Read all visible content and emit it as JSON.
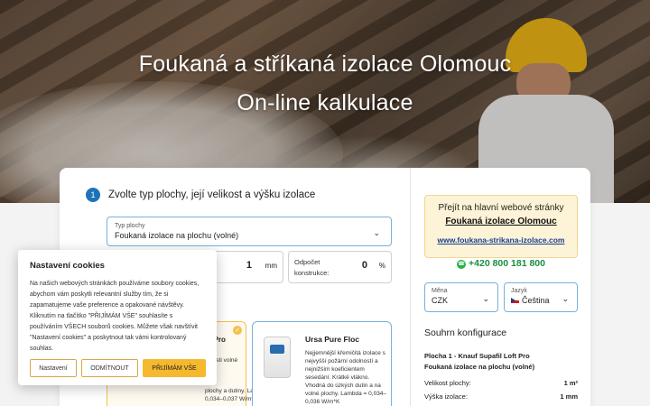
{
  "hero": {
    "title": "Foukaná a stříkaná izolace Olomouc",
    "subtitle": "On-line kalkulace"
  },
  "step1": {
    "number": "1",
    "label": "Zvolte typ plochy, její velikost a výšku izolace"
  },
  "surface_select": {
    "label": "Typ plochy",
    "value": "Foukaná izolace na plochu (volné)"
  },
  "area_field": {
    "value": "1",
    "unit": "mm"
  },
  "deduction_field": {
    "label": "Odpočet konstrukce:",
    "value": "0",
    "unit": "%"
  },
  "products": [
    {
      "name": "ft Pro",
      "desc_part1": "s nosti volné",
      "desc_part2": "plochy a dutiny. Lambda = 0,034–0,037 W/m*K"
    },
    {
      "name": "Ursa Pure Floc",
      "desc": "Nejjemnější křemičitá izolace s nejvyšší požární odolností a nejnižším koeficientem sesedání. Krátké vlákno. Vhodná do úzkých dutin a na volné plochy. Lambda = 0,034–0,036 W/m*K"
    }
  ],
  "promo": {
    "line1": "Přejít na hlavní webové stránky",
    "line2": "Foukaná izolace Olomouc",
    "link": "www.foukana-strikana-izolace.com"
  },
  "phone": "+420 800 181 800",
  "currency": {
    "label": "Měna",
    "value": "CZK"
  },
  "language": {
    "label": "Jazyk",
    "value": "Čeština"
  },
  "summary": {
    "title": "Souhrn konfigurace",
    "line1": "Plocha 1 - Knauf Supafil Loft Pro",
    "line2": "Foukaná izolace na plochu (volné)",
    "rows": [
      {
        "label": "Velikost plochy:",
        "value": "1 m²"
      },
      {
        "label": "Výška izolace:",
        "value": "1 mm"
      }
    ]
  },
  "cookie": {
    "title": "Nastavení cookies",
    "body": "Na našich webových stránkách používáme soubory cookies, abychom vám poskytli relevantní služby tím, že si zapamatujeme vaše preference a opakované návštěvy. Kliknutím na tlačítko \"PŘIJÍMÁM VŠE\" souhlasíte s používáním VŠECH souborů cookies. Můžete však navštívit \"Nastavení cookies\" a poskytnout tak vámi kontrolovaný souhlas.",
    "btn_settings": "Nastavení",
    "btn_reject": "ODMÍTNOUT",
    "btn_accept": "PŘIJÍMÁM VŠE"
  },
  "colors": {
    "accent_blue": "#1f72b9",
    "accent_yellow": "#f5b82e",
    "phone_green": "#1a8f3e"
  }
}
